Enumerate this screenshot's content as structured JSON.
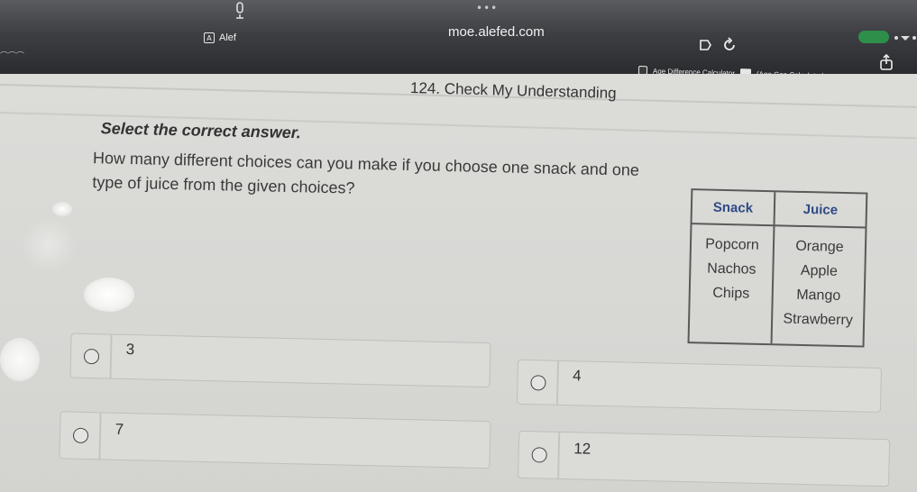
{
  "browser": {
    "url": "moe.alefed.com",
    "tab_label": "Alef",
    "bookmarks": [
      "Age Difference Calculator",
      "(Age Gap Calculator)"
    ]
  },
  "page": {
    "section_title": "124. Check My Understanding",
    "instruction": "Select the correct answer.",
    "question_line1": "How many different choices can you make if you choose one snack and one",
    "question_line2": "type of juice from the given choices?"
  },
  "table": {
    "headers": [
      "Snack",
      "Juice"
    ],
    "snacks": [
      "Popcorn",
      "Nachos",
      "Chips"
    ],
    "juices": [
      "Orange",
      "Apple",
      "Mango",
      "Strawberry"
    ]
  },
  "options": [
    "3",
    "4",
    "7",
    "12"
  ],
  "colors": {
    "header_text": "#2f4b86",
    "accent_green": "#2e8f4a"
  }
}
